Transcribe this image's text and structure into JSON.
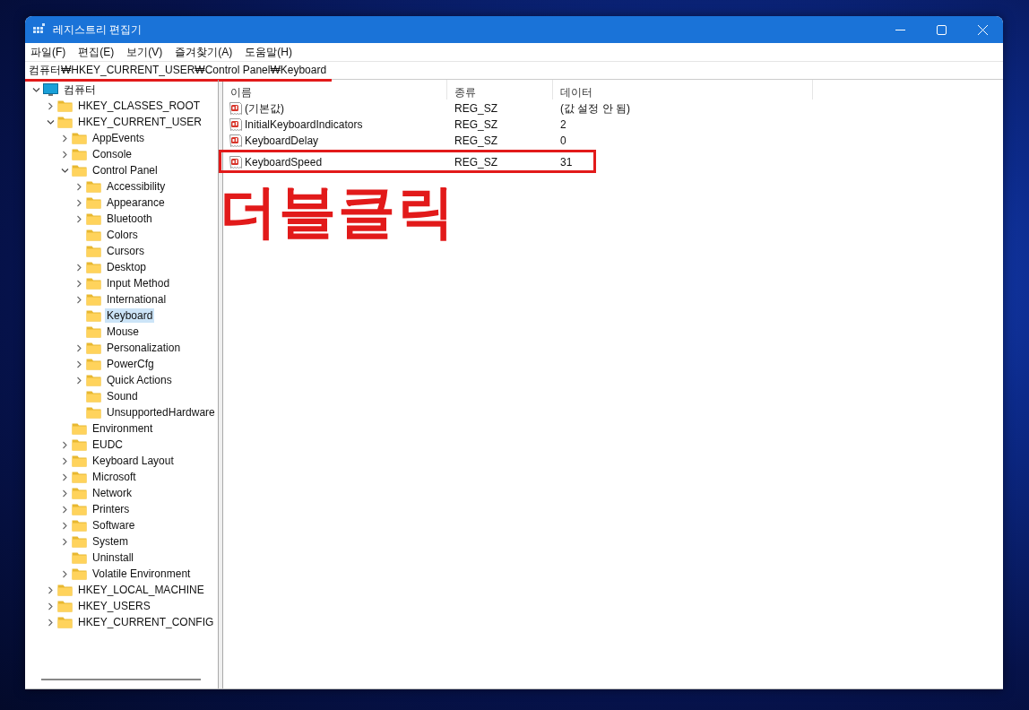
{
  "window": {
    "title": "레지스트리 편집기"
  },
  "menu": [
    "파일(F)",
    "편집(E)",
    "보기(V)",
    "즐겨찾기(A)",
    "도움말(H)"
  ],
  "address_bar": {
    "path": "컴퓨터₩HKEY_CURRENT_USER₩Control Panel₩Keyboard",
    "underlined": true
  },
  "tree": [
    {
      "name": "컴퓨터",
      "kind": "computer",
      "expanded": true,
      "selected": false,
      "children": [
        {
          "name": "HKEY_CLASSES_ROOT",
          "kind": "branch",
          "expanded": false,
          "selected": false
        },
        {
          "name": "HKEY_CURRENT_USER",
          "kind": "branch",
          "expanded": true,
          "selected": false,
          "children": [
            {
              "name": "AppEvents",
              "kind": "branch",
              "expanded": false,
              "selected": false
            },
            {
              "name": "Console",
              "kind": "branch",
              "expanded": false,
              "selected": false
            },
            {
              "name": "Control Panel",
              "kind": "branch",
              "expanded": true,
              "selected": false,
              "children": [
                {
                  "name": "Accessibility",
                  "kind": "branch",
                  "expanded": false,
                  "selected": false
                },
                {
                  "name": "Appearance",
                  "kind": "branch",
                  "expanded": false,
                  "selected": false
                },
                {
                  "name": "Bluetooth",
                  "kind": "branch",
                  "expanded": false,
                  "selected": false
                },
                {
                  "name": "Colors",
                  "kind": "leaf",
                  "selected": false
                },
                {
                  "name": "Cursors",
                  "kind": "leaf",
                  "selected": false
                },
                {
                  "name": "Desktop",
                  "kind": "branch",
                  "expanded": false,
                  "selected": false
                },
                {
                  "name": "Input Method",
                  "kind": "branch",
                  "expanded": false,
                  "selected": false
                },
                {
                  "name": "International",
                  "kind": "branch",
                  "expanded": false,
                  "selected": false
                },
                {
                  "name": "Keyboard",
                  "kind": "leaf",
                  "selected": true
                },
                {
                  "name": "Mouse",
                  "kind": "leaf",
                  "selected": false
                },
                {
                  "name": "Personalization",
                  "kind": "branch",
                  "expanded": false,
                  "selected": false
                },
                {
                  "name": "PowerCfg",
                  "kind": "branch",
                  "expanded": false,
                  "selected": false
                },
                {
                  "name": "Quick Actions",
                  "kind": "branch",
                  "expanded": false,
                  "selected": false
                },
                {
                  "name": "Sound",
                  "kind": "leaf",
                  "selected": false
                },
                {
                  "name": "UnsupportedHardware",
                  "kind": "leaf",
                  "selected": false
                }
              ]
            },
            {
              "name": "Environment",
              "kind": "leaf",
              "selected": false
            },
            {
              "name": "EUDC",
              "kind": "branch",
              "expanded": false,
              "selected": false
            },
            {
              "name": "Keyboard Layout",
              "kind": "branch",
              "expanded": false,
              "selected": false
            },
            {
              "name": "Microsoft",
              "kind": "branch",
              "expanded": false,
              "selected": false
            },
            {
              "name": "Network",
              "kind": "branch",
              "expanded": false,
              "selected": false
            },
            {
              "name": "Printers",
              "kind": "branch",
              "expanded": false,
              "selected": false
            },
            {
              "name": "Software",
              "kind": "branch",
              "expanded": false,
              "selected": false
            },
            {
              "name": "System",
              "kind": "branch",
              "expanded": false,
              "selected": false
            },
            {
              "name": "Uninstall",
              "kind": "leaf",
              "selected": false
            },
            {
              "name": "Volatile Environment",
              "kind": "branch",
              "expanded": false,
              "selected": false
            }
          ]
        },
        {
          "name": "HKEY_LOCAL_MACHINE",
          "kind": "branch",
          "expanded": false,
          "selected": false
        },
        {
          "name": "HKEY_USERS",
          "kind": "branch",
          "expanded": false,
          "selected": false
        },
        {
          "name": "HKEY_CURRENT_CONFIG",
          "kind": "branch",
          "expanded": false,
          "selected": false
        }
      ]
    }
  ],
  "values": {
    "columns": [
      "이름",
      "종류",
      "데이터"
    ],
    "rows": [
      {
        "name": "(기본값)",
        "type": "REG_SZ",
        "data": "(값 설정 안 됨)",
        "highlighted": false
      },
      {
        "name": "InitialKeyboardIndicators",
        "type": "REG_SZ",
        "data": "2",
        "highlighted": false
      },
      {
        "name": "KeyboardDelay",
        "type": "REG_SZ",
        "data": "0",
        "highlighted": false
      },
      {
        "name": "KeyboardSpeed",
        "type": "REG_SZ",
        "data": "31",
        "highlighted": true
      }
    ]
  },
  "caption": "더블클릭"
}
